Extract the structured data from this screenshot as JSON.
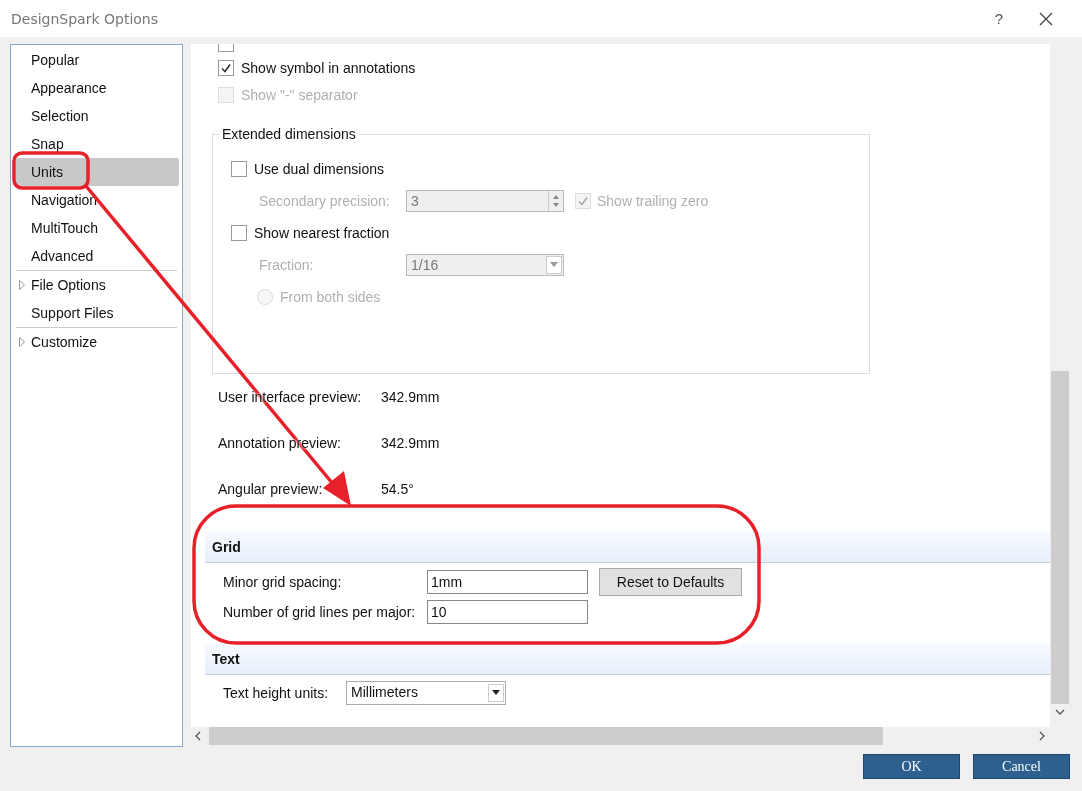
{
  "window": {
    "title": "DesignSpark Options",
    "help": "?"
  },
  "sidebar": {
    "sections": [
      [
        {
          "label": "Popular",
          "selected": false,
          "kind": "page"
        },
        {
          "label": "Appearance",
          "selected": false,
          "kind": "page"
        },
        {
          "label": "Selection",
          "selected": false,
          "kind": "page"
        },
        {
          "label": "Snap",
          "selected": false,
          "kind": "page"
        },
        {
          "label": "Units",
          "selected": true,
          "kind": "page"
        },
        {
          "label": "Navigation",
          "selected": false,
          "kind": "page"
        },
        {
          "label": "MultiTouch",
          "selected": false,
          "kind": "page"
        },
        {
          "label": "Advanced",
          "selected": false,
          "kind": "page"
        }
      ],
      [
        {
          "label": "File Options",
          "selected": false,
          "kind": "group"
        },
        {
          "label": "Support Files",
          "selected": false,
          "kind": "page"
        }
      ],
      [
        {
          "label": "Customize",
          "selected": false,
          "kind": "group"
        }
      ]
    ]
  },
  "cut_option": {
    "checked": false
  },
  "options": [
    {
      "label": "Show symbol in annotations",
      "checked": true,
      "disabled": false
    },
    {
      "label": "Show \"-\" separator",
      "checked": false,
      "disabled": true
    }
  ],
  "extended_dimensions": {
    "title": "Extended dimensions",
    "items": [
      {
        "kind": "checkbox",
        "label": "Use dual dimensions",
        "checked": false,
        "disabled": false
      },
      {
        "kind": "spin",
        "label": "Secondary precision:",
        "value": "3",
        "disabled": true,
        "check": {
          "label": "Show trailing zero",
          "checked": true,
          "disabled": true
        }
      },
      {
        "kind": "checkbox",
        "label": "Show nearest fraction",
        "checked": false,
        "disabled": false
      },
      {
        "kind": "dropdown",
        "label": "Fraction:",
        "value": "1/16",
        "disabled": true
      },
      {
        "kind": "radio",
        "label": "From both sides",
        "selected": false,
        "disabled": true
      }
    ]
  },
  "previews": [
    {
      "label": "User interface preview:",
      "value": "342.9mm"
    },
    {
      "label": "Annotation preview:",
      "value": "342.9mm"
    },
    {
      "label": "Angular preview:",
      "value": "54.5°"
    }
  ],
  "grid": {
    "title": "Grid",
    "fields": [
      {
        "label": "Minor grid spacing:",
        "value": "1mm"
      },
      {
        "label": "Number of grid lines per major:",
        "value": "10"
      }
    ],
    "button": "Reset to Defaults"
  },
  "text": {
    "title": "Text",
    "label": "Text height units:",
    "value": "Millimeters"
  },
  "buttons": [
    "OK",
    "Cancel"
  ]
}
